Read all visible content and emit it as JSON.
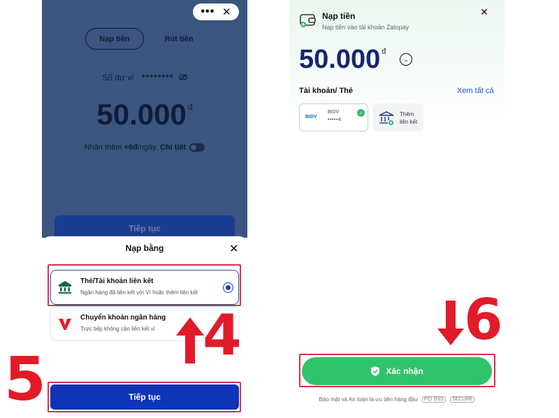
{
  "left_screen": {
    "topbar": {
      "more_icon": "more-dots-icon",
      "close_icon": "close-icon"
    },
    "tabs": [
      {
        "label": "Nạp tiền",
        "active": true
      },
      {
        "label": "Rút tiền",
        "active": false
      }
    ],
    "balance": {
      "label": "Số dư ví",
      "masked": "********",
      "eye_icon": "eye-off-icon"
    },
    "amount": {
      "value": "50.000",
      "currency": "đ"
    },
    "promo": {
      "prefix": "Nhận thêm",
      "bonus": "+6đ",
      "suffix": "/ngày.",
      "detail_link": "Chi tiết"
    },
    "dim_continue_label": "Tiếp tục",
    "sheet": {
      "title": "Nạp bằng",
      "options": [
        {
          "title": "Thẻ/Tài khoản liên kết",
          "subtitle": "Ngân hàng đã liên kết với Ví hoặc thêm liên kết",
          "icon": "bank-icon",
          "selected": true
        },
        {
          "title": "Chuyển khoản ngân hàng",
          "subtitle": "Trực tiếp không cần liên kết ví",
          "icon": "vietqr-icon",
          "selected": false
        }
      ],
      "continue_label": "Tiếp tục"
    }
  },
  "right_screen": {
    "header": {
      "title": "Nạp tiền",
      "subtitle": "Nạp tiền vào tài khoản Zalopay",
      "icon": "wallet-icon"
    },
    "amount": {
      "value": "50.000",
      "currency": "đ"
    },
    "accounts_label": "Tài khoản/ Thẻ",
    "see_all": "Xem tất cả",
    "bank_card": {
      "logo": "BIDV",
      "name": "BIDV",
      "masked": "•••••4"
    },
    "add_card_label_line1": "Thêm",
    "add_card_label_line2": "liên kết",
    "confirm_label": "Xác nhận",
    "footer": {
      "text": "Bảo mật và An toàn là ưu tiên hàng đầu",
      "badge1": "PCI DSS",
      "badge2": "SECURE"
    }
  },
  "steps": {
    "four": "4",
    "five": "5",
    "six": "6"
  },
  "colors": {
    "highlight": "#d9304a",
    "step_number": "#e11b2a",
    "primary_blue": "#0f34b8",
    "confirm_green": "#2fc46a"
  }
}
